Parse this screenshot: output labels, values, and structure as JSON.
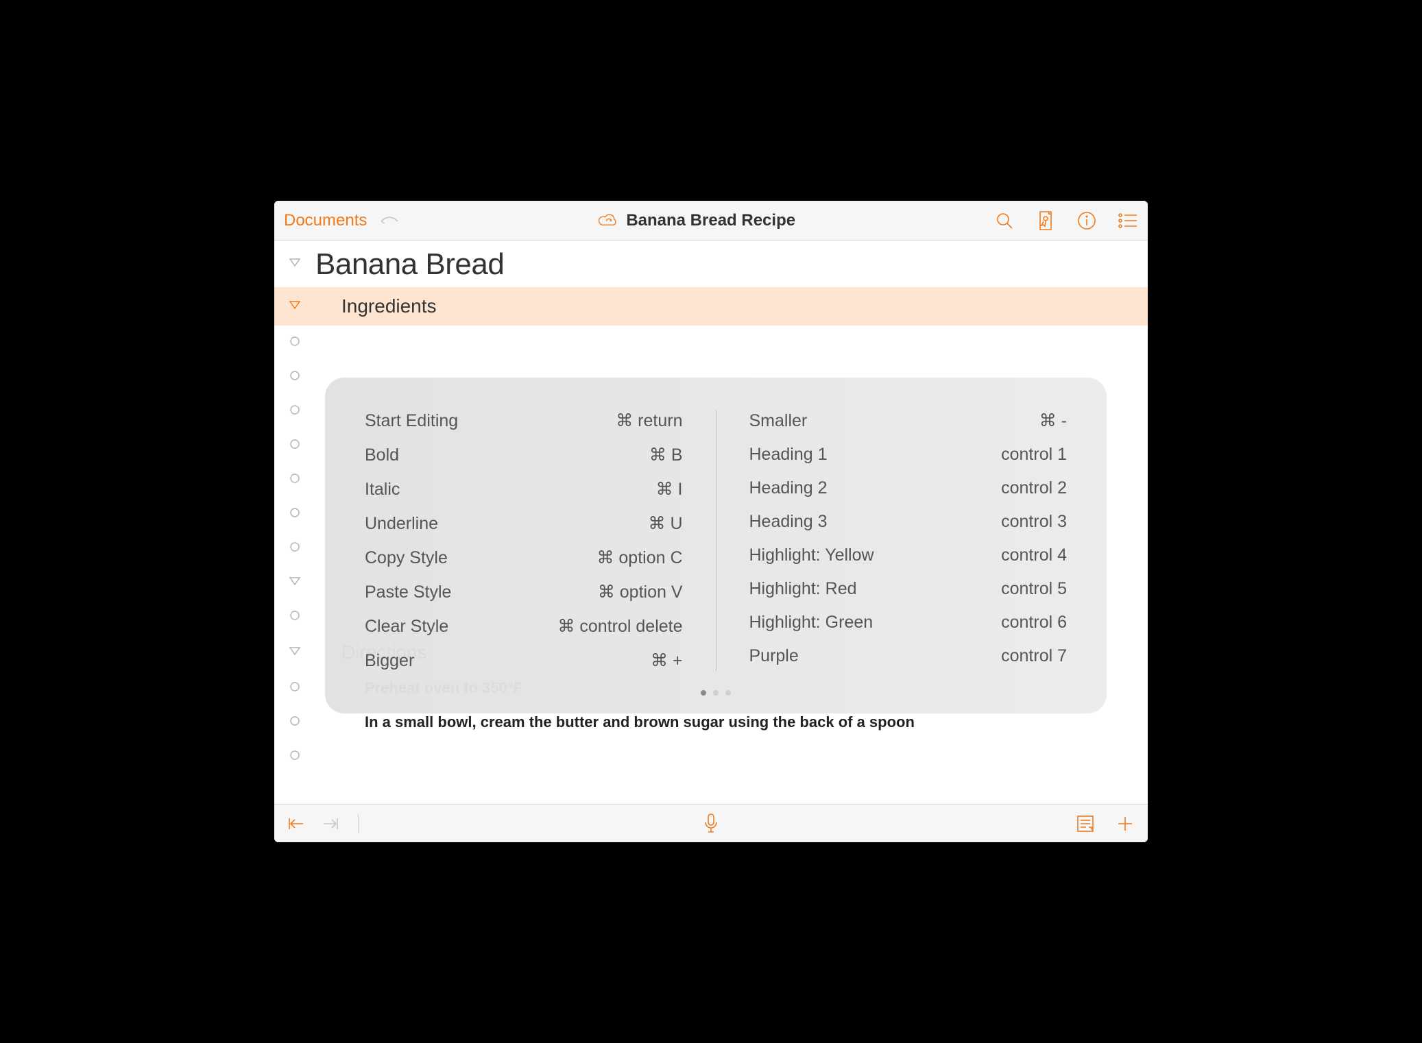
{
  "toolbar": {
    "documents_label": "Documents",
    "title": "Banana Bread Recipe"
  },
  "outline": {
    "title": "Banana Bread",
    "section_ingredients": "Ingredients",
    "section_directions": "Directions",
    "dir_step1": "Preheat oven to 350°F",
    "dir_step2": "In a small bowl, cream the butter and brown sugar using the back of a spoon"
  },
  "shortcuts": {
    "left": [
      {
        "label": "Start Editing",
        "keys": "⌘  return"
      },
      {
        "label": "Bold",
        "keys": "⌘  B"
      },
      {
        "label": "Italic",
        "keys": "⌘  I"
      },
      {
        "label": "Underline",
        "keys": "⌘  U"
      },
      {
        "label": "Copy Style",
        "keys": "⌘  option C"
      },
      {
        "label": "Paste Style",
        "keys": "⌘  option V"
      },
      {
        "label": "Clear Style",
        "keys": "⌘  control delete"
      },
      {
        "label": "Bigger",
        "keys": "⌘  +"
      }
    ],
    "right": [
      {
        "label": "Smaller",
        "keys": "⌘  -"
      },
      {
        "label": "Heading 1",
        "keys": "control 1"
      },
      {
        "label": "Heading 2",
        "keys": "control 2"
      },
      {
        "label": "Heading 3",
        "keys": "control 3"
      },
      {
        "label": "Highlight: Yellow",
        "keys": "control 4"
      },
      {
        "label": "Highlight: Red",
        "keys": "control 5"
      },
      {
        "label": "Highlight: Green",
        "keys": "control 6"
      },
      {
        "label": "Purple",
        "keys": "control 7"
      }
    ]
  }
}
